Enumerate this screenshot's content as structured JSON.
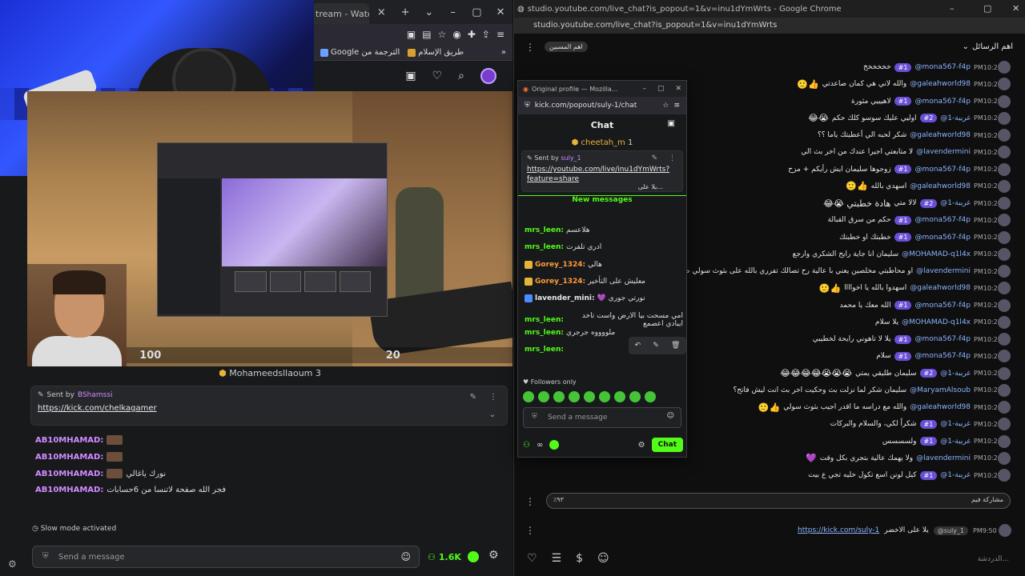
{
  "left": {
    "browser_tab": "tream - Watch Li",
    "bookmarks": [
      "Google الترجمة من",
      "طريق الإسلام"
    ],
    "hud": {
      "health": "100",
      "ammo": "20"
    },
    "pinned_top_user": "Mohameedsllaoum",
    "pinned_top_count": "3",
    "pinned": {
      "sent_by_label": "Sent by",
      "sent_by_user": "BShamssi",
      "link": "https://kick.com/chelkagamer"
    },
    "messages": [
      {
        "user": "AB10MHAMAD:",
        "text": ""
      },
      {
        "user": "AB10MHAMAD:",
        "text": ""
      },
      {
        "user": "AB10MHAMAD:",
        "text": "نورك ياغالي"
      },
      {
        "user": "AB10MHAMAD:",
        "text": "فجر الله صفحة لاتنسا من 6حسابات"
      }
    ],
    "slow_mode": "Slow mode activated",
    "input_placeholder": "Send a message",
    "viewers": "1.6K"
  },
  "right": {
    "title": "studio.youtube.com/live_chat?is_popout=1&v=inu1dYmWrts - Google Chrome",
    "url": "studio.youtube.com/live_chat?is_popout=1&v=inu1dYmWrts",
    "header": "اهم الرسائل",
    "chip": "اهم المسبين",
    "rows": [
      {
        "time": "PM10:23",
        "name": "@mona567-f4p",
        "badge": "#1",
        "text": "خخخخخخ",
        "emo": ""
      },
      {
        "time": "PM10:23",
        "name": "@galeahworld98",
        "badge": "",
        "text": "والله لاني هي كمان صاعدتي",
        "emo": "🙂👍"
      },
      {
        "time": "PM10:23",
        "name": "@mona567-f4p",
        "badge": "#1",
        "text": "لاهيييي مثورة",
        "emo": ""
      },
      {
        "time": "PM10:24",
        "name": "@غريبة-1",
        "badge": "#2",
        "text": "اوليي عليك سوسو كلك حكم",
        "emo": "😂😭"
      },
      {
        "time": "PM10:24",
        "name": "@galeahworld98",
        "badge": "",
        "text": "شكر لحبه الي أعطيتك ياما ؟؟",
        "emo": ""
      },
      {
        "time": "PM10:24",
        "name": "@lavendermini",
        "badge": "",
        "text": "لا متابعتي اجيرا عندك من اخر بث الي",
        "emo": ""
      },
      {
        "time": "PM10:24",
        "name": "@mona567-f4p",
        "badge": "#1",
        "text": "زوجوها سليمان ايش رأيكم + مزح",
        "emo": ""
      },
      {
        "time": "PM10:24",
        "name": "@galeahworld98",
        "badge": "",
        "text": "اسهدي بالله",
        "emo": "🙂👍"
      },
      {
        "time": "PM10:24",
        "name": "@غريبة-1",
        "badge": "#2",
        "text": "لالا متي",
        "emo": "😂😭 هادة خطبتي"
      },
      {
        "time": "PM10:24",
        "name": "@mona567-f4p",
        "badge": "#1",
        "text": "حكم من سرق القبالة",
        "emo": ""
      },
      {
        "time": "PM10:25",
        "name": "@mona567-f4p",
        "badge": "#1",
        "text": "خطبتك او خطبتك",
        "emo": ""
      },
      {
        "time": "PM10:25",
        "name": "@MOHAMAD-q1l4x",
        "badge": "",
        "text": "سليمان انا جاية رايح الشكري وارجع",
        "emo": ""
      },
      {
        "time": "PM10:25",
        "name": "@lavendermini",
        "badge": "",
        "text": "او محاطبتي مخلصين يعني با عالية رح تصالك تفرري بالله على بثوث سولي صح؟",
        "emo": "💜"
      },
      {
        "time": "PM10:25",
        "name": "@galeahworld98",
        "badge": "",
        "text": "اسهدوا بالله يا اخواااا",
        "emo": "🙂👍"
      },
      {
        "time": "PM10:25",
        "name": "@mona567-f4p",
        "badge": "#1",
        "text": "الله معك يا محمد",
        "emo": ""
      },
      {
        "time": "PM10:25",
        "name": "@MOHAMAD-q1l4x",
        "badge": "",
        "text": "يلا سلام",
        "emo": ""
      },
      {
        "time": "PM10:25",
        "name": "@mona567-f4p",
        "badge": "#1",
        "text": "يلا لا تاهوني رايحة لخطيبي",
        "emo": ""
      },
      {
        "time": "PM10:25",
        "name": "@mona567-f4p",
        "badge": "#1",
        "text": "سلام",
        "emo": ""
      },
      {
        "time": "PM10:25",
        "name": "@غريبة-1",
        "badge": "#2",
        "text": "سليمان طليقي يمتي",
        "emo": "😂😂😂😂😭😭😭"
      },
      {
        "time": "PM10:25",
        "name": "@MaryamAlsoub",
        "badge": "",
        "text": "سليمان شكر لما نزلت بث وحكيت اخر بث انت ليش فاتح؟",
        "emo": ""
      },
      {
        "time": "PM10:25",
        "name": "@galeahworld98",
        "badge": "",
        "text": "والله مع دراسه ما اقدر اجيب بثوث سولي",
        "emo": "🙂👍"
      },
      {
        "time": "PM10:25",
        "name": "@غريبة-1",
        "badge": "#1",
        "text": "شكراً لكي، والسلام والبركات",
        "emo": ""
      },
      {
        "time": "PM10:26",
        "name": "@غريبة-1",
        "badge": "#1",
        "text": "ولسسسس",
        "emo": ""
      },
      {
        "time": "PM10:26",
        "name": "@lavendermini",
        "badge": "",
        "text": "ولا يهمك عالية بتجري بكل وقت",
        "emo": "💜"
      },
      {
        "time": "PM10:26",
        "name": "@غريبة-1",
        "badge": "#1",
        "text": "كيل لونن اسع تكول خليه تجي ع بيت",
        "emo": ""
      }
    ],
    "bottom_input_left": "٪٩٣",
    "bottom_input_right": "مشاركة فيم",
    "link_row": {
      "time": "PM9:50",
      "user": "@suly_1",
      "text": "يلا على الاخضر",
      "link": "https://kick.com/suly-1"
    },
    "placeholder": "الدردشة..."
  },
  "kick": {
    "title": "Original profile — Mozilla...",
    "url": "kick.com/popout/suly-1/chat",
    "header": "Chat",
    "crown_user": "cheetah_m",
    "crown_count": "1",
    "pinned": {
      "sent_by_label": "Sent by",
      "sent_by_user": "suly_1",
      "link": "https://youtube.com/live/inu1dYmWrts?feature=share",
      "suffix": "يلا على..."
    },
    "new_messages": "New messages",
    "messages": [
      {
        "user": "mrs_leen:",
        "text": "هلاعسم",
        "style": "green",
        "badge": ""
      },
      {
        "user": "mrs_leen:",
        "text": "ادري تلفرت",
        "style": "green",
        "badge": ""
      },
      {
        "user": "Gorey_1324:",
        "text": "هالي",
        "style": "orange",
        "badge": "gold"
      },
      {
        "user": "Gorey_1324:",
        "text": "معليش على التأخير",
        "style": "orange",
        "badge": "gold"
      },
      {
        "user": "lavender_mini:",
        "text": "نورتي جوري 💜",
        "style": "white",
        "badge": "blue"
      },
      {
        "user": "mrs_leen:",
        "text": "امي مسحت بيا الارض واست تاخد ايبادي اعصمع",
        "style": "green",
        "badge": ""
      },
      {
        "user": "mrs_leen:",
        "text": "ملووووه جرجري",
        "style": "green",
        "badge": ""
      },
      {
        "user": "mrs_leen:",
        "text": "",
        "style": "green",
        "badge": ""
      }
    ],
    "followers_only": "Followers only",
    "input_placeholder": "Send a message",
    "chat_button": "Chat"
  }
}
